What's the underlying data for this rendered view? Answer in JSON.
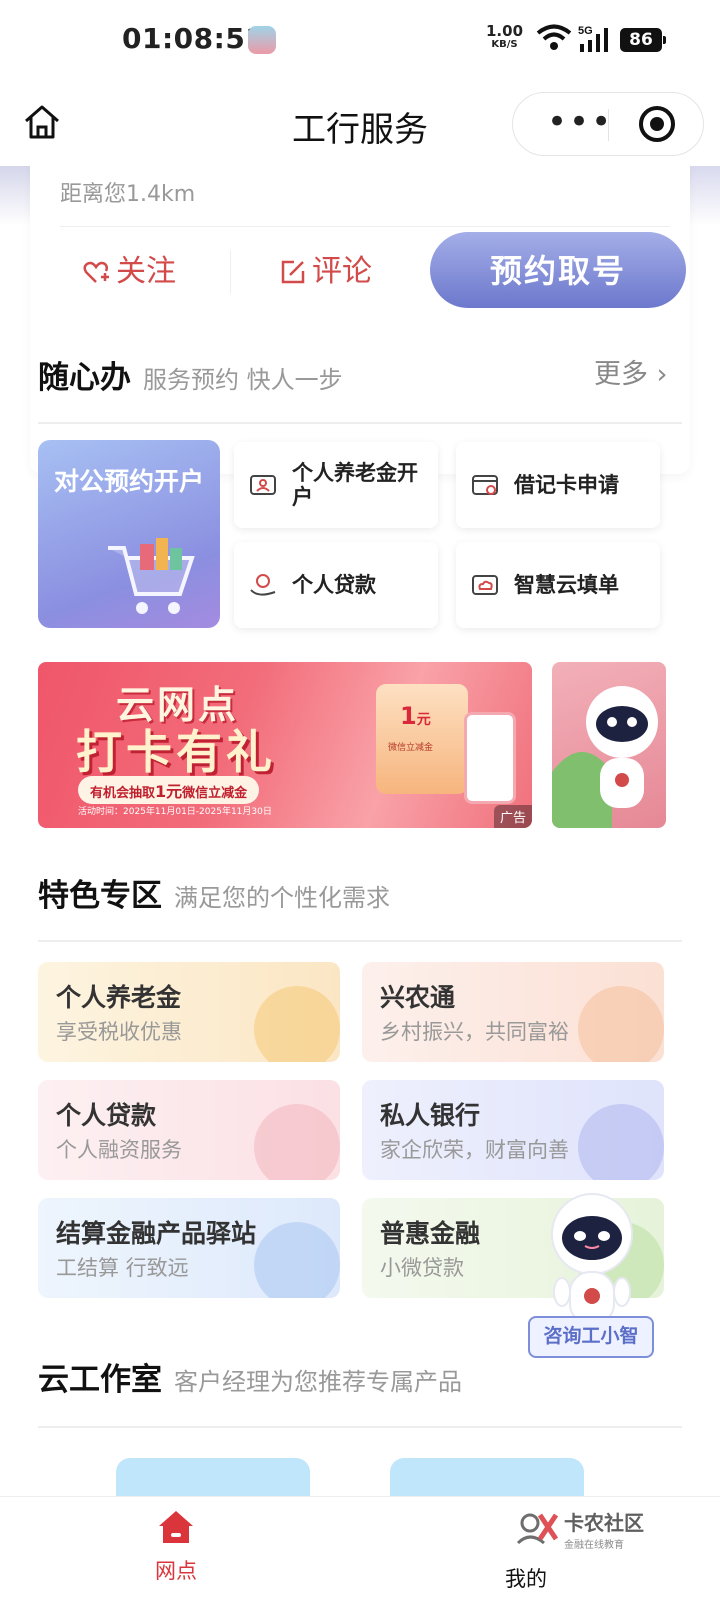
{
  "status_bar": {
    "time": "01:08:51",
    "net_speed": "1.00",
    "net_unit": "KB/S",
    "network": "5G",
    "battery": "86"
  },
  "nav": {
    "title": "工行服务"
  },
  "info_card": {
    "distance": "距离您1.4km",
    "follow_label": "关注",
    "comment_label": "评论",
    "reserve_label": "预约取号"
  },
  "quick_service": {
    "title": "随心办",
    "subtitle": "服务预约 快人一步",
    "more_label": "更多",
    "big_item": "对公预约开户",
    "items": [
      "个人养老金开户",
      "借记卡申请",
      "个人贷款",
      "智慧云填单"
    ]
  },
  "banner": {
    "line1": "云网点",
    "line2": "打卡有礼",
    "line3_before": "有机会抽取",
    "line3_highlight": "1元",
    "line3_after": "微信立减金",
    "period": "活动时间：2025年11月01日-2025年11月30日",
    "coupon_amount": "1",
    "coupon_unit": "元",
    "coupon_label": "微信立减金",
    "ad_tag": "广告"
  },
  "featured": {
    "title": "特色专区",
    "subtitle": "满足您的个性化需求",
    "items": [
      {
        "title": "个人养老金",
        "subtitle": "享受税收优惠"
      },
      {
        "title": "兴农通",
        "subtitle": "乡村振兴，共同富裕"
      },
      {
        "title": "个人贷款",
        "subtitle": "个人融资服务"
      },
      {
        "title": "私人银行",
        "subtitle": "家企欣荣，财富向善"
      },
      {
        "title": "结算金融产品驿站",
        "subtitle": "工结算 行致远"
      },
      {
        "title": "普惠金融",
        "subtitle": "小微贷款"
      }
    ],
    "colors": [
      "#fdf1d8",
      "#fde9e4",
      "#fde8ec",
      "#e6e8fc",
      "#e6f0fd",
      "#edf6e6"
    ]
  },
  "assistant": {
    "label": "咨询工小智"
  },
  "studio": {
    "title": "云工作室",
    "subtitle": "客户经理为您推荐专属产品"
  },
  "tabbar": {
    "home_label": "网点",
    "mine_label": "我的"
  },
  "watermark": {
    "name": "卡农社区",
    "tagline": "金融在线教育"
  },
  "colors": {
    "accent": "#d9353a",
    "reserve_button": "#7e89d6"
  }
}
